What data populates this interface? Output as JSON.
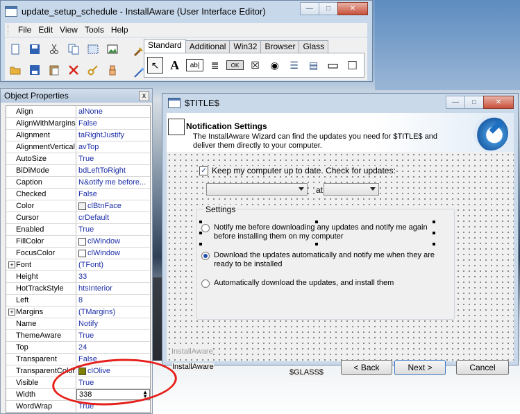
{
  "main_window": {
    "title": "update_setup_schedule - InstallAware (User Interface Editor)",
    "controls": {
      "minimize": "—",
      "maximize": "□",
      "close": "✕"
    },
    "menu": [
      "File",
      "Edit",
      "View",
      "Tools",
      "Help"
    ],
    "toolbar_icons": [
      "new-icon",
      "save-icon",
      "cut-icon",
      "copy-icon",
      "select-all-icon",
      "image-icon",
      "tools-icon",
      "open-icon",
      "save-all-icon",
      "paste-icon",
      "delete-icon",
      "key-icon",
      "hand-icon",
      "wand-icon"
    ],
    "palette_tabs": [
      "Standard",
      "Additional",
      "Win32",
      "Browser",
      "Glass"
    ],
    "palette_items": [
      {
        "name": "pointer-tool-icon",
        "glyph": "↖"
      },
      {
        "name": "label-tool-icon",
        "glyph": "A"
      },
      {
        "name": "edit-tool-icon",
        "glyph": "ab|"
      },
      {
        "name": "memo-tool-icon",
        "glyph": "≣"
      },
      {
        "name": "button-tool-icon",
        "glyph": "OK"
      },
      {
        "name": "checkbox-tool-icon",
        "glyph": "☒"
      },
      {
        "name": "radiobutton-tool-icon",
        "glyph": "◉"
      },
      {
        "name": "listbox-tool-icon",
        "glyph": "☰"
      },
      {
        "name": "combobox-tool-icon",
        "glyph": "▤"
      },
      {
        "name": "groupbox-tool-icon",
        "glyph": "▭"
      },
      {
        "name": "panel-tool-icon",
        "glyph": "□"
      }
    ]
  },
  "props_panel": {
    "title": "Object Properties",
    "close": "x",
    "rows": [
      {
        "name": "Align",
        "value": "alNone"
      },
      {
        "name": "AlignWithMargins",
        "value": "False"
      },
      {
        "name": "Alignment",
        "value": "taRightJustify"
      },
      {
        "name": "AlignmentVertical",
        "value": "avTop"
      },
      {
        "name": "AutoSize",
        "value": "True"
      },
      {
        "name": "BiDiMode",
        "value": "bdLeftToRight"
      },
      {
        "name": "Caption",
        "value": "N&otify me before..."
      },
      {
        "name": "Checked",
        "value": "False"
      },
      {
        "name": "Color",
        "value": "clBtnFace",
        "swatch": "#f0f0f0"
      },
      {
        "name": "Cursor",
        "value": "crDefault"
      },
      {
        "name": "Enabled",
        "value": "True"
      },
      {
        "name": "FillColor",
        "value": "clWindow",
        "swatch": "#ffffff"
      },
      {
        "name": "FocusColor",
        "value": "clWindow",
        "swatch": "#ffffff"
      },
      {
        "name": "Font",
        "value": "(TFont)",
        "expandable": true
      },
      {
        "name": "Height",
        "value": "33"
      },
      {
        "name": "HotTrackStyle",
        "value": "htsInterior"
      },
      {
        "name": "Left",
        "value": "8"
      },
      {
        "name": "Margins",
        "value": "(TMargins)",
        "expandable": true
      },
      {
        "name": "Name",
        "value": "Notify"
      },
      {
        "name": "ThemeAware",
        "value": "True"
      },
      {
        "name": "Top",
        "value": "24"
      },
      {
        "name": "Transparent",
        "value": "False"
      },
      {
        "name": "TransparentColor",
        "value": "clOlive",
        "swatch": "#808000"
      },
      {
        "name": "Visible",
        "value": "True"
      },
      {
        "name": "Width",
        "value": "338",
        "active": true
      },
      {
        "name": "WordWrap",
        "value": "True"
      }
    ]
  },
  "wizard": {
    "title": "$TITLE$",
    "header_title": "Notification Settings",
    "header_desc": "The InstallAware Wizard can find the updates you need for $TITLE$ and deliver them directly to your computer.",
    "keep_up_to_date": "Keep my computer up to date. Check for updates:",
    "keep_checked": true,
    "at_label": "at",
    "group_label": "Settings",
    "options": [
      {
        "label": "Notify me before downloading any updates and notify me again before installing them on my computer",
        "selected": false
      },
      {
        "label": "Download the updates automatically and notify me when they are ready to be installed",
        "selected": true
      },
      {
        "label": "Automatically download the updates, and install them",
        "selected": false
      }
    ],
    "footer_brand_gray": "InstallAware",
    "footer_brand": "InstallAware",
    "glass_label": "$GLASS$",
    "buttons": {
      "back": "< Back",
      "next": "Next >",
      "cancel": "Cancel"
    }
  },
  "colors": {
    "annotation": "#e5201b",
    "value_text": "#1d2fa8"
  }
}
